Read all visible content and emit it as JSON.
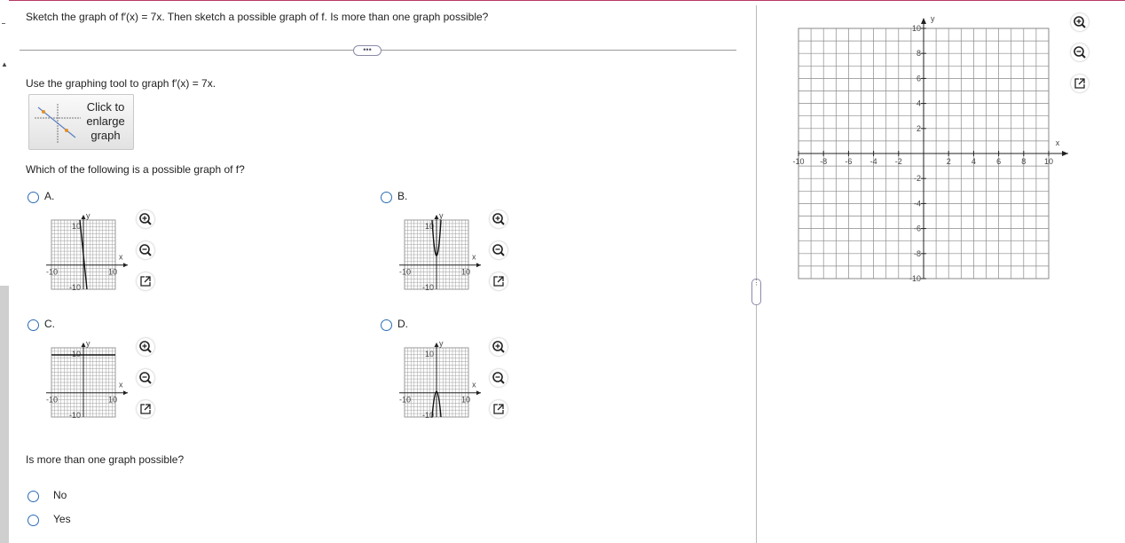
{
  "question": {
    "prompt": "Sketch the graph of f′(x) = 7x. Then sketch a possible graph of f. Is more than one graph possible?",
    "instruction": "Use the graphing tool to graph f′(x) = 7x.",
    "enlarge_button_lines": [
      "Click to",
      "enlarge",
      "graph"
    ],
    "which_prompt": "Which of the following is a possible graph of f?",
    "more_prompt": "Is more than one graph possible?",
    "expand_dots": "•••"
  },
  "options": [
    {
      "label": "A.",
      "shape": "line"
    },
    {
      "label": "B.",
      "shape": "upward-parabola"
    },
    {
      "label": "C.",
      "shape": "horizontal-line"
    },
    {
      "label": "D.",
      "shape": "downward-parabola"
    }
  ],
  "mini_axis": {
    "max_label": "10",
    "min_label": "-10",
    "neg_x_label": "-10",
    "pos_x_label": "10",
    "x_label": "x",
    "y_label": "y"
  },
  "yes_no": [
    {
      "label": "No"
    },
    {
      "label": "Yes"
    }
  ],
  "main_graph": {
    "x_ticks": [
      "-10",
      "-8",
      "-6",
      "-4",
      "-2",
      "2",
      "4",
      "6",
      "8",
      "10"
    ],
    "y_ticks": [
      "10",
      "8",
      "6",
      "4",
      "2",
      "-2",
      "-4",
      "-6",
      "-8",
      "-10"
    ],
    "x_label": "x",
    "y_label": "y",
    "range": [
      -10,
      10
    ],
    "grid": true
  },
  "icons": {
    "zoom_in": "zoom-in-icon",
    "zoom_out": "zoom-out-icon",
    "popout": "popout-icon",
    "accent": "#2d6cb5"
  }
}
